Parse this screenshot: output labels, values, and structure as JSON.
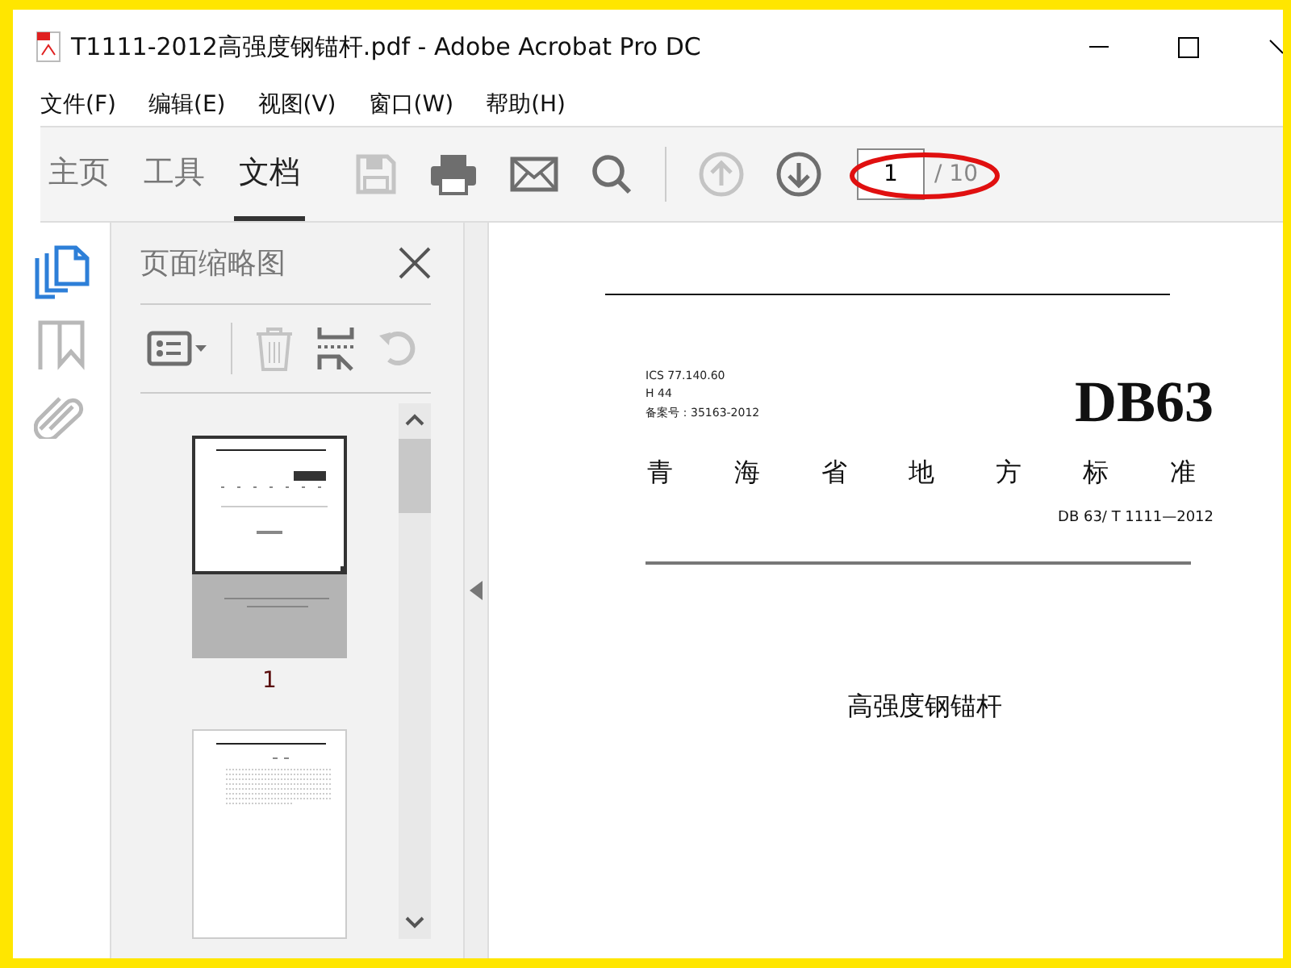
{
  "window": {
    "title": "T1111-2012高强度钢锚杆.pdf - Adobe Acrobat Pro DC"
  },
  "menu": [
    "文件(F)",
    "编辑(E)",
    "视图(V)",
    "窗口(W)",
    "帮助(H)"
  ],
  "tabs": [
    {
      "label": "主页",
      "selected": false
    },
    {
      "label": "工具",
      "selected": false
    },
    {
      "label": "文档",
      "selected": true
    }
  ],
  "toolbar": [
    {
      "kind": "save",
      "disabled": true
    },
    {
      "kind": "print",
      "disabled": false
    },
    {
      "kind": "mail",
      "disabled": false
    },
    {
      "kind": "search",
      "disabled": false
    }
  ],
  "page_nav": {
    "buttons": [
      {
        "kind": "up",
        "disabled": true
      },
      {
        "kind": "down",
        "disabled": false
      }
    ],
    "current": "1",
    "total": "/ 10",
    "highlighted": true
  },
  "side_rail": [
    {
      "kind": "pages",
      "selected": true
    },
    {
      "kind": "bookmarks",
      "selected": false
    },
    {
      "kind": "attachments",
      "selected": false
    }
  ],
  "thumbnails_panel": {
    "title": "页面缩略图",
    "tools": [
      {
        "kind": "options",
        "disabled": false
      },
      {
        "kind": "delete",
        "disabled": true
      },
      {
        "kind": "insert",
        "disabled": false
      },
      {
        "kind": "undo",
        "disabled": true
      }
    ],
    "pages": [
      {
        "kind": "cover",
        "label": "1",
        "selected": true
      },
      {
        "kind": "contents",
        "selected": false
      }
    ]
  },
  "document": {
    "ics": "ICS 77.140.60",
    "code": "H 44",
    "record": "备案号：35163-2012",
    "logo": "DB63",
    "org_chars": [
      "青",
      "海",
      "省",
      "地",
      "方",
      "标",
      "准"
    ],
    "standard_number": "DB 63/ T 1111—2012",
    "doc_title": "高强度钢锚杆"
  }
}
